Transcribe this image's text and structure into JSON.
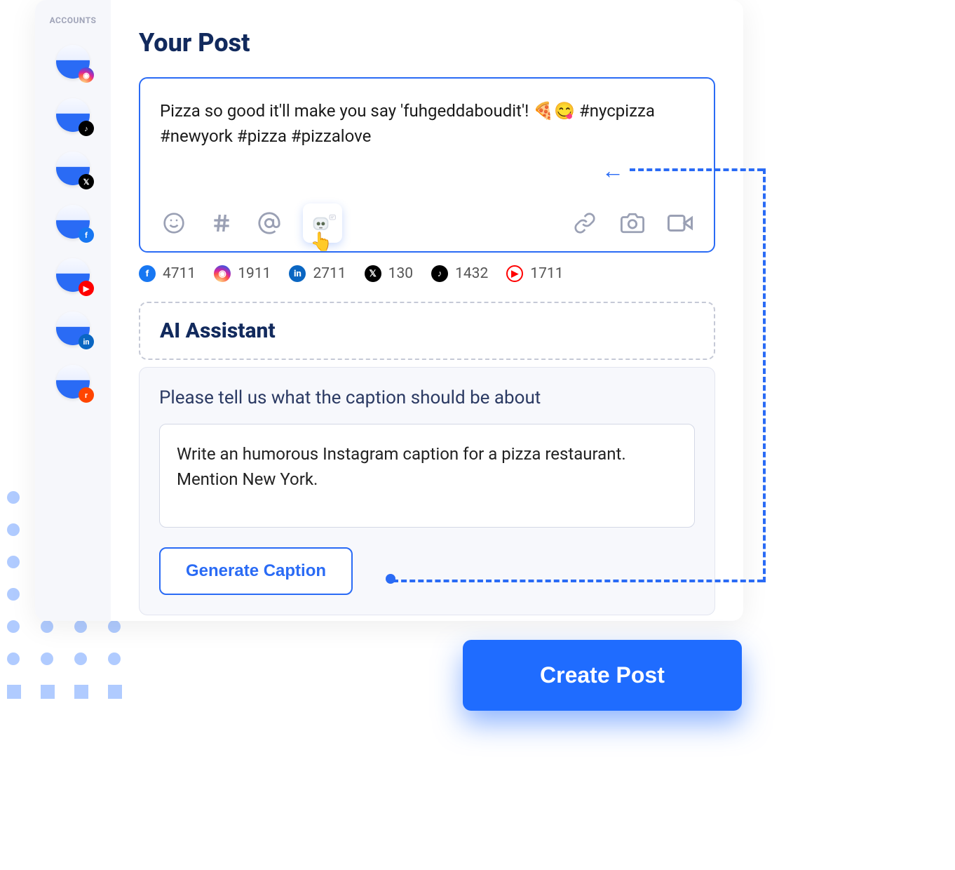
{
  "sidebar": {
    "label": "ACCOUNTS",
    "accounts": [
      {
        "badge": "ig",
        "name": "instagram-account"
      },
      {
        "badge": "tt",
        "name": "tiktok-account"
      },
      {
        "badge": "x",
        "name": "x-account"
      },
      {
        "badge": "fb",
        "name": "facebook-account"
      },
      {
        "badge": "yt",
        "name": "youtube-account"
      },
      {
        "badge": "in",
        "name": "linkedin-account"
      },
      {
        "badge": "rd",
        "name": "reddit-account"
      }
    ]
  },
  "post": {
    "title": "Your Post",
    "text": "Pizza so good it'll make you say 'fuhgeddaboudit'! 🍕😋 #nycpizza #newyork #pizza #pizzalove"
  },
  "counts": {
    "facebook": "4711",
    "instagram": "1911",
    "linkedin": "2711",
    "x": "130",
    "tiktok": "1432",
    "youtube": "1711"
  },
  "ai": {
    "header": "AI Assistant",
    "prompt_label": "Please tell us what the caption should be about",
    "prompt_value": "Write an humorous Instagram caption for a pizza restaurant. Mention New York.",
    "generate_label": "Generate Caption"
  },
  "create_button": "Create Post"
}
